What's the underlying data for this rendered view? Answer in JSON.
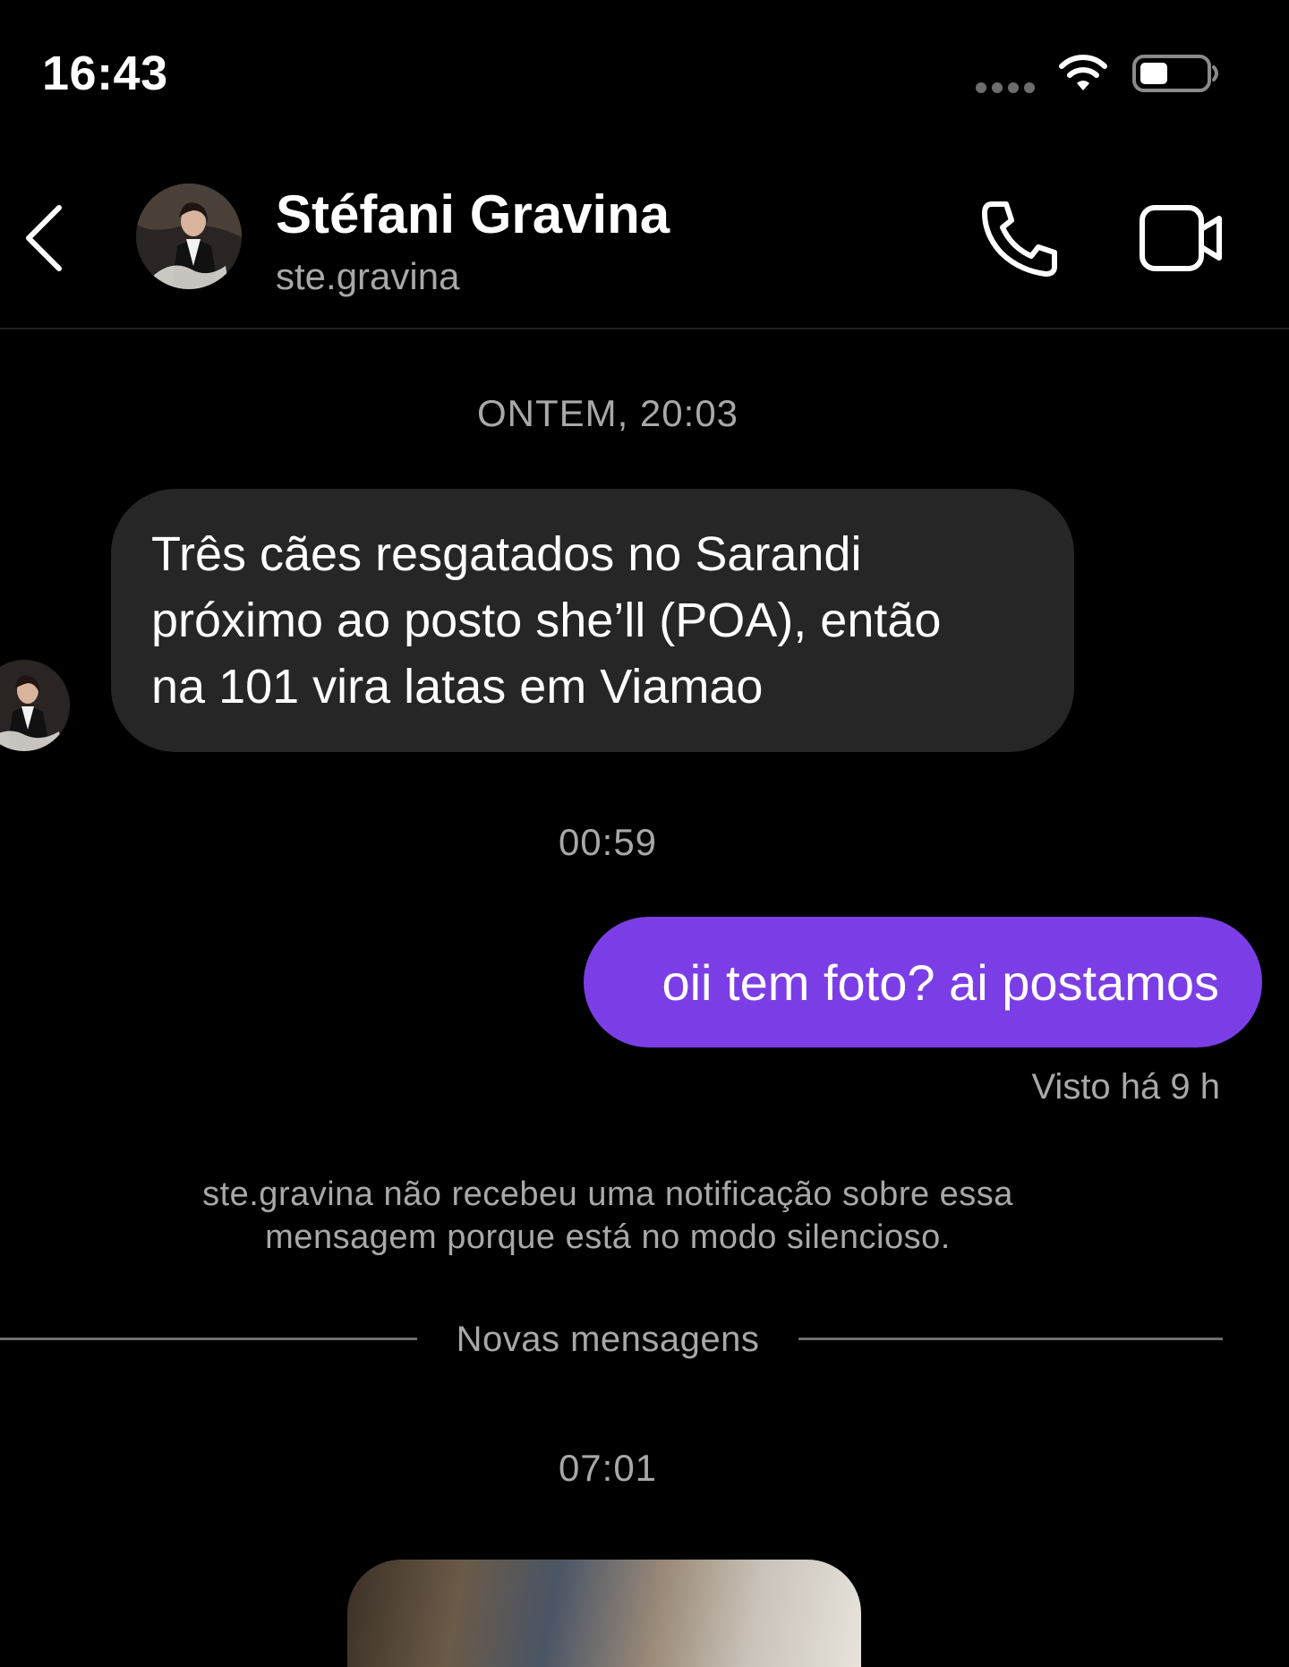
{
  "status_bar": {
    "time": "16:43"
  },
  "header": {
    "contact_name": "Stéfani Gravina",
    "contact_username": "ste.gravina",
    "icons": [
      "back-icon",
      "phone-icon",
      "video-camera-icon"
    ]
  },
  "conversation": {
    "timestamp_1": "ONTEM, 20:03",
    "incoming_message": {
      "lines": [
        "Três cães resgatados no Sarandi",
        "próximo ao posto she’ll (POA), então",
        "na 101 vira latas em Viamao"
      ]
    },
    "timestamp_2": "00:59",
    "outgoing_message": {
      "text": "oii tem foto? ai postamos",
      "seen": "Visto há 9 h"
    },
    "silent_notice": {
      "line1": "ste.gravina não recebeu uma notificação sobre essa",
      "line2": "mensagem porque está no modo silencioso."
    },
    "new_messages_label": "Novas mensagens",
    "timestamp_3": "07:01"
  },
  "colors": {
    "background": "#000000",
    "incoming_bubble": "#262626",
    "outgoing_bubble": "#7b3ee6",
    "secondary_text": "#a8a8a8"
  }
}
